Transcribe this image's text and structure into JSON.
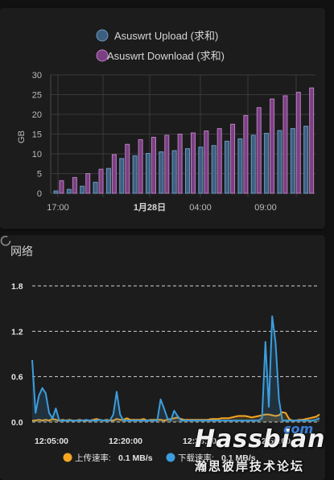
{
  "usage_card": {
    "legend": [
      {
        "label": "Asuswrt Upload (求和)",
        "color": "#3c5f80",
        "border": "#6e98c0"
      },
      {
        "label": "Asuswrt Download (求和)",
        "color": "#7b3f82",
        "border": "#b77fc0"
      }
    ],
    "chart_data": {
      "type": "bar",
      "ylabel": "GB",
      "ylim": [
        0,
        30
      ],
      "yticks": [
        "0",
        "5",
        "10",
        "15",
        "20",
        "25",
        "30"
      ],
      "xticks": [
        "17:00",
        "1月28日",
        "04:00",
        "09:00"
      ],
      "series": [
        {
          "name": "Asuswrt Upload (求和)",
          "values": [
            0.6,
            1.0,
            1.8,
            2.8,
            6.3,
            8.8,
            9.5,
            10.1,
            10.5,
            10.8,
            11.3,
            11.7,
            12.1,
            13.2,
            13.8,
            14.7,
            15.2,
            15.9,
            16.4,
            17.0
          ]
        },
        {
          "name": "Asuswrt Download (求和)",
          "values": [
            3.2,
            4.0,
            5.0,
            6.1,
            9.8,
            12.4,
            13.6,
            14.2,
            14.7,
            15.0,
            15.3,
            15.8,
            16.4,
            17.5,
            19.7,
            21.7,
            23.9,
            24.7,
            25.6,
            26.7
          ]
        }
      ]
    }
  },
  "network_card": {
    "title": "网络",
    "refresh_icon": "refresh-icon",
    "legend": [
      {
        "label": "上传速率:",
        "value": "0.1 MB/s",
        "color": "#f5a623"
      },
      {
        "label": "下载速率:",
        "value": "0.1 MB/s",
        "color": "#3b9ddd"
      }
    ],
    "chart_data": {
      "type": "line",
      "ylim": [
        0,
        1.8
      ],
      "yticks": [
        "0.0",
        "0.6",
        "1.2",
        "1.8"
      ],
      "xticks": [
        "12:05:00",
        "12:20:00",
        "12:35:00",
        "12:50:00"
      ],
      "series": [
        {
          "name": "上传速率",
          "color": "#f5a623",
          "values": [
            0.02,
            0.02,
            0.03,
            0.02,
            0.03,
            0.02,
            0.04,
            0.03,
            0.02,
            0.03,
            0.02,
            0.03,
            0.02,
            0.02,
            0.03,
            0.02,
            0.02,
            0.02,
            0.03,
            0.04,
            0.03,
            0.02,
            0.03,
            0.02,
            0.02,
            0.04,
            0.03,
            0.03,
            0.05,
            0.03,
            0.03,
            0.03,
            0.03,
            0.04,
            0.02,
            0.03,
            0.03,
            0.03,
            0.03,
            0.02,
            0.03,
            0.04,
            0.05,
            0.06,
            0.04,
            0.03,
            0.03,
            0.03,
            0.03,
            0.03,
            0.03,
            0.03,
            0.03,
            0.04,
            0.04,
            0.04,
            0.05,
            0.05,
            0.05,
            0.06,
            0.07,
            0.08,
            0.08,
            0.08,
            0.07,
            0.06,
            0.07,
            0.08,
            0.09,
            0.1,
            0.1,
            0.09,
            0.08,
            0.09,
            0.13,
            0.12,
            0.04,
            0.02,
            0.02,
            0.03,
            0.03,
            0.04,
            0.05,
            0.06,
            0.07,
            0.1
          ]
        },
        {
          "name": "下载速率",
          "color": "#3b9ddd",
          "values": [
            0.82,
            0.12,
            0.35,
            0.45,
            0.38,
            0.12,
            0.05,
            0.18,
            0.02,
            0.02,
            0.02,
            0.02,
            0.02,
            0.02,
            0.02,
            0.02,
            0.03,
            0.02,
            0.02,
            0.02,
            0.03,
            0.02,
            0.02,
            0.02,
            0.1,
            0.4,
            0.1,
            0.02,
            0.02,
            0.02,
            0.02,
            0.02,
            0.02,
            0.02,
            0.02,
            0.02,
            0.02,
            0.02,
            0.3,
            0.18,
            0.05,
            0.02,
            0.15,
            0.08,
            0.02,
            0.02,
            0.02,
            0.02,
            0.02,
            0.02,
            0.02,
            0.02,
            0.02,
            0.02,
            0.02,
            0.02,
            0.02,
            0.02,
            0.02,
            0.02,
            0.02,
            0.02,
            0.02,
            0.02,
            0.02,
            0.02,
            0.02,
            0.02,
            0.05,
            1.06,
            0.2,
            1.4,
            1.05,
            0.3,
            0.02,
            0.02,
            0.02,
            0.02,
            0.02,
            0.02,
            0.02,
            0.02,
            0.02,
            0.02,
            0.03,
            0.05
          ]
        }
      ]
    }
  },
  "watermark": {
    "main": "Hassbian",
    "suffix": "com",
    "sub": "瀚思彼岸技术论坛"
  }
}
